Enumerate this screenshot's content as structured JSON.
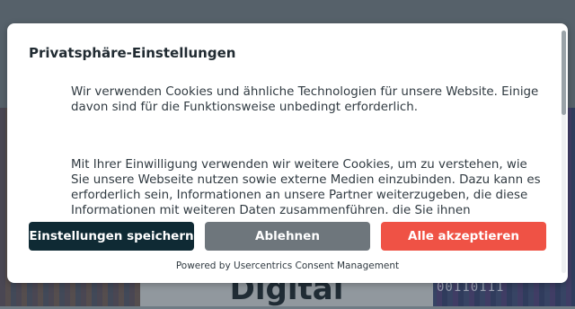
{
  "background": {
    "center_text": "Digital",
    "right_text": "00110111"
  },
  "dialog": {
    "title": "Privatsphäre-Einstellungen",
    "paragraph_1": "Wir verwenden Cookies und ähnliche Technologien für unsere Website. Einige davon sind für die Funktionsweise unbedingt erforderlich.",
    "paragraph_2": "Mit Ihrer Einwilligung verwenden wir weitere Cookies, um zu verstehen, wie Sie unsere Webseite nutzen sowie externe Medien einzubinden. Dazu kann es erforderlich sein, Informationen an unsere Partner weiterzugeben, die diese Informationen mit weiteren Daten zusammenführen, die Sie ihnen",
    "buttons": {
      "save": "Einstellungen speichern",
      "deny": "Ablehnen",
      "accept": "Alle akzeptieren"
    },
    "powered_by": "Powered by Usercentrics Consent Management"
  },
  "colors": {
    "save_button": "#0f2a34",
    "deny_button": "#6e767c",
    "accept_button": "#ef5245"
  }
}
